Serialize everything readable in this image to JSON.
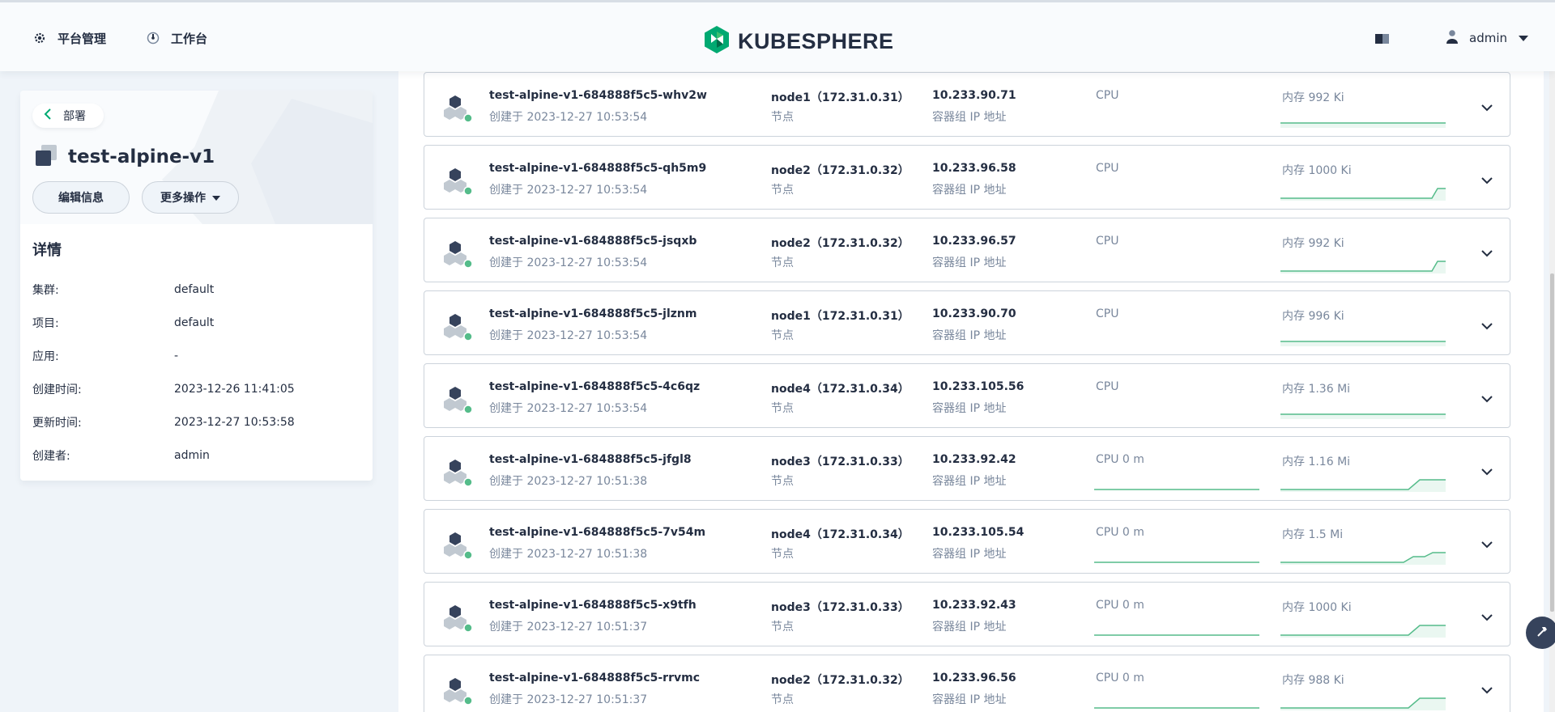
{
  "topbar": {
    "platform_label": "平台管理",
    "workbench_label": "工作台",
    "brand": "KUBESPHERE",
    "user": "admin"
  },
  "sidebar": {
    "back_label": "部署",
    "title": "test-alpine-v1",
    "edit_label": "编辑信息",
    "more_label": "更多操作",
    "details_title": "详情",
    "details": [
      {
        "key": "集群:",
        "value": "default"
      },
      {
        "key": "项目:",
        "value": "default"
      },
      {
        "key": "应用:",
        "value": "-"
      },
      {
        "key": "创建时间:",
        "value": "2023-12-26 11:41:05"
      },
      {
        "key": "更新时间:",
        "value": "2023-12-27 10:53:58"
      },
      {
        "key": "创建者:",
        "value": "admin"
      }
    ]
  },
  "labels": {
    "node": "节点",
    "pod_ip": "容器组 IP 地址"
  },
  "pods": [
    {
      "name": "test-alpine-v1-684888f5c5-whv2w",
      "created": "创建于 2023-12-27 10:53:54",
      "node": "node1（172.31.0.31）",
      "ip": "10.233.90.71",
      "cpu": "CPU",
      "mem": "内存 992 Ki",
      "cpu_chart": false,
      "mem_trend": "flat"
    },
    {
      "name": "test-alpine-v1-684888f5c5-qh5m9",
      "created": "创建于 2023-12-27 10:53:54",
      "node": "node2（172.31.0.32）",
      "ip": "10.233.96.58",
      "cpu": "CPU",
      "mem": "内存 1000 Ki",
      "cpu_chart": false,
      "mem_trend": "late-step"
    },
    {
      "name": "test-alpine-v1-684888f5c5-jsqxb",
      "created": "创建于 2023-12-27 10:53:54",
      "node": "node2（172.31.0.32）",
      "ip": "10.233.96.57",
      "cpu": "CPU",
      "mem": "内存 992 Ki",
      "cpu_chart": false,
      "mem_trend": "late-step"
    },
    {
      "name": "test-alpine-v1-684888f5c5-jlznm",
      "created": "创建于 2023-12-27 10:53:54",
      "node": "node1（172.31.0.31）",
      "ip": "10.233.90.70",
      "cpu": "CPU",
      "mem": "内存 996 Ki",
      "cpu_chart": false,
      "mem_trend": "flat"
    },
    {
      "name": "test-alpine-v1-684888f5c5-4c6qz",
      "created": "创建于 2023-12-27 10:53:54",
      "node": "node4（172.31.0.34）",
      "ip": "10.233.105.56",
      "cpu": "CPU",
      "mem": "内存 1.36 Mi",
      "cpu_chart": false,
      "mem_trend": "flat"
    },
    {
      "name": "test-alpine-v1-684888f5c5-jfgl8",
      "created": "创建于 2023-12-27 10:51:38",
      "node": "node3（172.31.0.33）",
      "ip": "10.233.92.42",
      "cpu": "CPU 0 m",
      "mem": "内存 1.16 Mi",
      "cpu_chart": true,
      "mem_trend": "step"
    },
    {
      "name": "test-alpine-v1-684888f5c5-7v54m",
      "created": "创建于 2023-12-27 10:51:38",
      "node": "node4（172.31.0.34）",
      "ip": "10.233.105.54",
      "cpu": "CPU 0 m",
      "mem": "内存 1.5 Mi",
      "cpu_chart": true,
      "mem_trend": "double-step"
    },
    {
      "name": "test-alpine-v1-684888f5c5-x9tfh",
      "created": "创建于 2023-12-27 10:51:37",
      "node": "node3（172.31.0.33）",
      "ip": "10.233.92.43",
      "cpu": "CPU 0 m",
      "mem": "内存 1000 Ki",
      "cpu_chart": true,
      "mem_trend": "step"
    },
    {
      "name": "test-alpine-v1-684888f5c5-rrvmc",
      "created": "创建于 2023-12-27 10:51:37",
      "node": "node2（172.31.0.32）",
      "ip": "10.233.96.56",
      "cpu": "CPU 0 m",
      "mem": "内存 988 Ki",
      "cpu_chart": true,
      "mem_trend": "step"
    }
  ],
  "colors": {
    "accent_green": "#55bc8a",
    "text_primary": "#242e42",
    "text_secondary": "#79879c",
    "border": "#ccd3db"
  },
  "icons": [
    "gear-icon",
    "dashboard-icon",
    "kubesphere-logo-icon",
    "docs-icon",
    "user-icon",
    "caret-down-icon",
    "back-arrow-icon",
    "deployment-icon",
    "pod-icon",
    "chevron-down-icon",
    "hammer-icon"
  ]
}
